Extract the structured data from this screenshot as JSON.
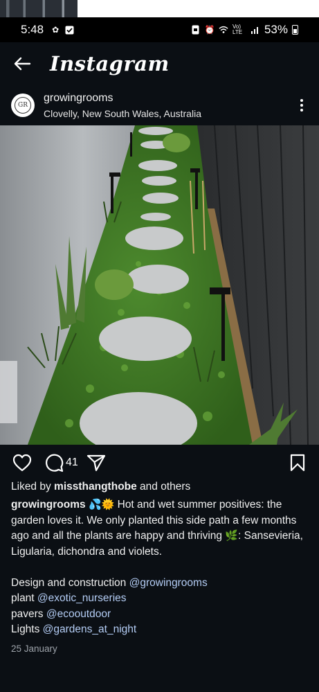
{
  "status_bar": {
    "time": "5:48",
    "network": "Vo) LTE",
    "battery": "53%"
  },
  "header": {
    "back_icon": "arrow-left-icon",
    "logo": "Instagram"
  },
  "post": {
    "avatar_text": "GR",
    "username": "growingrooms",
    "location": "Clovelly, New South Wales, Australia",
    "photo_alt": "photo",
    "comment_count": "41",
    "liked_by_prefix": "Liked by ",
    "liked_by_user": "missthangthobe",
    "liked_by_suffix": " and others",
    "caption_user": "growingrooms",
    "caption_emoji_1": "💦🌞",
    "caption_text_1": " Hot and wet summer positives: the garden loves it. We only planted this side path a few months ago and all the plants are happy and thriving ",
    "caption_emoji_2": "🌿",
    "caption_text_2": ": Sansevieria, Ligularia, dichondra and violets.",
    "credits": [
      {
        "label": "Design and construction ",
        "mention": "@growingrooms"
      },
      {
        "label": "plant ",
        "mention": "@exotic_nurseries"
      },
      {
        "label": "pavers ",
        "mention": "@ecooutdoor"
      },
      {
        "label": "Lights ",
        "mention": "@gardens_at_night"
      }
    ],
    "date": "25 January"
  },
  "colors": {
    "background": "#0b0f14",
    "mention": "#b4cdf5",
    "date": "#9da3aa"
  }
}
